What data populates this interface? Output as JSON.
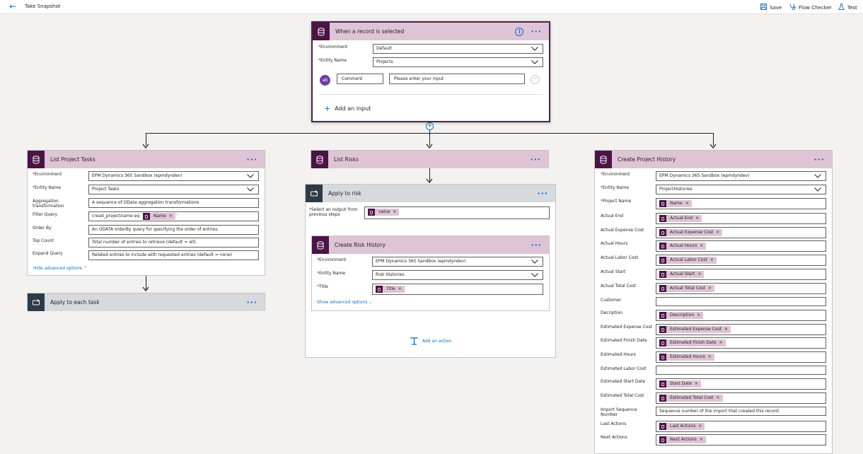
{
  "topbar": {
    "title": "Take Snapshot",
    "save": "Save",
    "flow_checker": "Flow Checker",
    "test": "Test"
  },
  "trigger": {
    "title": "When a record is selected",
    "environment_label": "Environment",
    "environment_value": "Default",
    "entity_label": "Entity Name",
    "entity_value": "Projects",
    "comment_name": "Comment",
    "comment_placeholder": "Please enter your input",
    "add_input": "Add an input"
  },
  "list_tasks": {
    "title": "List Project Tasks",
    "environment_label": "Environment",
    "environment_value": "EPM Dynamics 365 Sandbox (epmdyndev)",
    "entity_label": "Entity Name",
    "entity_value": "Project Tasks",
    "aggregation_label": "Aggregation transformation",
    "aggregation_value": "A sequence of OData aggregation transformations",
    "filter_label": "Filter Query",
    "filter_prefix": "cread_projectname eq",
    "filter_token": "Name",
    "filter_suffix": "'",
    "order_label": "Order By",
    "order_value": "An ODATA orderBy query for specifying the order of entries.",
    "top_label": "Top Count",
    "top_value": "Total number of entries to retrieve (default = all).",
    "expand_label": "Expand Query",
    "expand_value": "Related entries to include with requested entries (default = none)",
    "hide_options": "Hide advanced options"
  },
  "apply_each_task": {
    "title": "Apply to each task"
  },
  "list_risks": {
    "title": "List Risks"
  },
  "apply_risk": {
    "title": "Apply to risk",
    "select_label": "Select an output from previous steps",
    "select_token": "value",
    "add_action": "Add an action"
  },
  "risk_history": {
    "title": "Create Risk History",
    "environment_label": "Environment",
    "environment_value": "EPM Dynamics 365 Sandbox (epmdyndev)",
    "entity_label": "Entity Name",
    "entity_value": "Risk Histories",
    "title_label": "Title",
    "title_token": "Title",
    "show_options": "Show advanced options"
  },
  "project_history": {
    "title": "Create Project History",
    "fields": [
      {
        "label": "Environment",
        "required": "*",
        "type": "dropdown",
        "value": "EPM Dynamics 365 Sandbox (epmdyndev)"
      },
      {
        "label": "Entity Name",
        "required": "*",
        "type": "dropdown",
        "value": "ProjectHistories"
      },
      {
        "label": "Project Name",
        "required": "*",
        "type": "token",
        "value": "Name"
      },
      {
        "label": "Actual End",
        "required": "",
        "type": "token",
        "value": "Actual End"
      },
      {
        "label": "Actual Expense Cost",
        "required": "",
        "type": "token",
        "value": "Actual Expense Cost"
      },
      {
        "label": "Actual Hours",
        "required": "",
        "type": "token",
        "value": "Actual Hours"
      },
      {
        "label": "Actual Labor Cost",
        "required": "",
        "type": "token",
        "value": "Actual Labor Cost"
      },
      {
        "label": "Actual Start",
        "required": "",
        "type": "token",
        "value": "Actual Start"
      },
      {
        "label": "Actual Total Cost",
        "required": "",
        "type": "token",
        "value": "Actual Total Cost"
      },
      {
        "label": "Customer",
        "required": "",
        "type": "text",
        "value": ""
      },
      {
        "label": "Decription",
        "required": "",
        "type": "token",
        "value": "Description"
      },
      {
        "label": "Estimated Expense Cost",
        "required": "",
        "type": "token",
        "value": "Estimated Expense Cost"
      },
      {
        "label": "Estimated Finish Date",
        "required": "",
        "type": "token",
        "value": "Estimated Finish Date"
      },
      {
        "label": "Estimated Hours",
        "required": "",
        "type": "token",
        "value": "Estimated Hours"
      },
      {
        "label": "Estimated Labor Cost",
        "required": "",
        "type": "text",
        "value": ""
      },
      {
        "label": "Estimated Start Date",
        "required": "",
        "type": "token",
        "value": "Start Date"
      },
      {
        "label": "Estimated Total Cost",
        "required": "",
        "type": "token",
        "value": "Estimated Total Cost"
      },
      {
        "label": "Import Sequence Number",
        "required": "",
        "type": "text",
        "value": "Sequence number of the import that created this record."
      },
      {
        "label": "Last Actions",
        "required": "",
        "type": "token",
        "value": "Last Actions"
      },
      {
        "label": "Next Actions",
        "required": "",
        "type": "token",
        "value": "Next Actions"
      }
    ]
  },
  "icons": {
    "back": "arrow-left-icon",
    "save": "floppy-disk-icon",
    "flow_checker": "stethoscope-icon",
    "test": "flask-icon",
    "dataverse": "database-icon",
    "loop": "loop-icon",
    "info": "info-icon",
    "more": "ellipsis-icon",
    "plus": "plus-icon",
    "remove": "x-icon",
    "chevron": "chevron-down-icon"
  },
  "colors": {
    "header_purple": "#dec4d6",
    "icon_purple": "#4b1445",
    "header_gray": "#d6d9de",
    "accent_blue": "#0f6cbd"
  }
}
